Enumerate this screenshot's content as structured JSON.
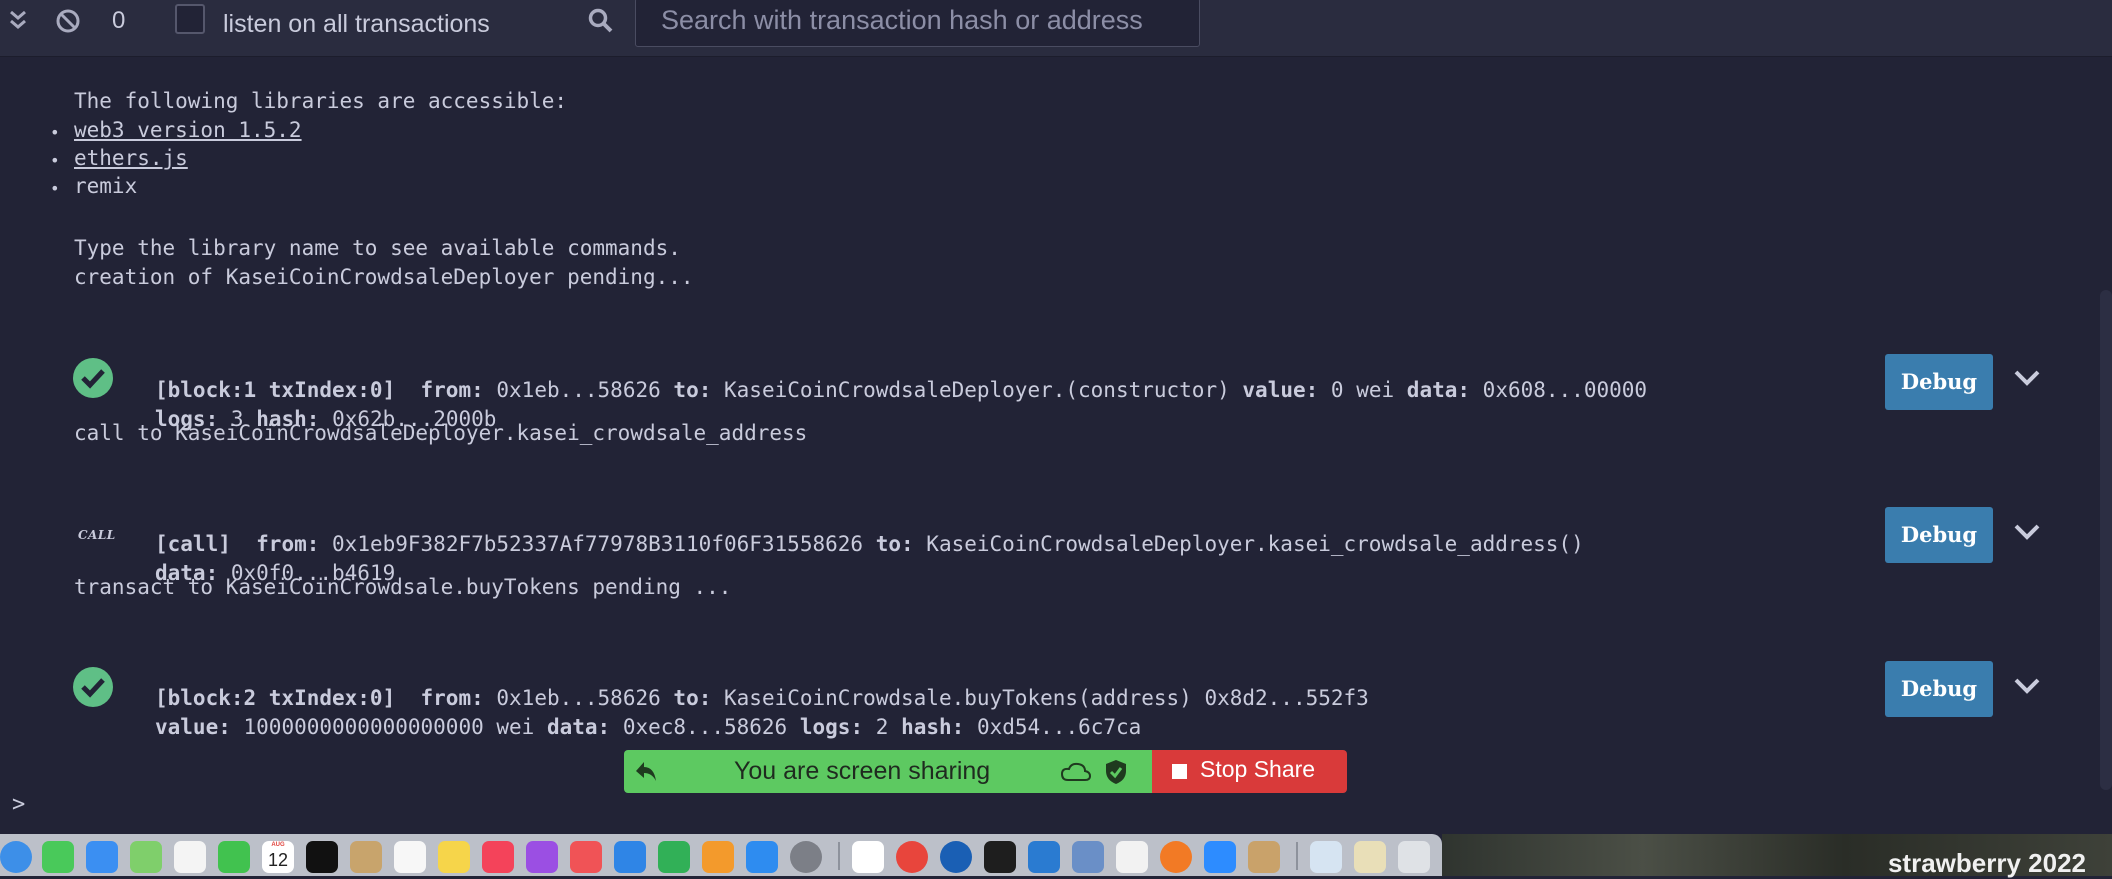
{
  "topbar": {
    "count": "0",
    "listen_label": "listen on all transactions",
    "search_placeholder": "Search with transaction hash or address"
  },
  "terminal": {
    "intro": "The following libraries are accessible:",
    "libraries": [
      "web3 version 1.5.2",
      "ethers.js",
      "remix"
    ],
    "help": "Type the library name to see available commands.",
    "creation_pending": "creation of KaseiCoinCrowdsaleDeployer pending...",
    "tx1": {
      "block": "[block:1 txIndex:0]",
      "from_label": "from:",
      "from": "0x1eb...58626",
      "to_label": "to:",
      "to": "KaseiCoinCrowdsaleDeployer.(constructor)",
      "value_label": "value:",
      "value": "0 wei",
      "data_label": "data:",
      "data": "0x608...00000",
      "logs_label": "logs:",
      "logs": "3",
      "hash_label": "hash:",
      "hash": "0x62b...2000b"
    },
    "call_line": "call to KaseiCoinCrowdsaleDeployer.kasei_crowdsale_address",
    "call_tag": "CALL",
    "tx2": {
      "block": "[call]",
      "from_label": "from:",
      "from": "0x1eb9F382F7b52337Af77978B3110f06F31558626",
      "to_label": "to:",
      "to": "KaseiCoinCrowdsaleDeployer.kasei_crowdsale_address()",
      "data_label": "data:",
      "data": "0x0f0...b4619"
    },
    "transact_line": "transact to KaseiCoinCrowdsale.buyTokens pending ...",
    "tx3": {
      "block": "[block:2 txIndex:0]",
      "from_label": "from:",
      "from": "0x1eb...58626",
      "to_label": "to:",
      "to": "KaseiCoinCrowdsale.buyTokens(address) 0x8d2...552f3",
      "value_label": "value:",
      "value": "1000000000000000000 wei",
      "data_label": "data:",
      "data": "0xec8...58626",
      "logs_label": "logs:",
      "logs": "2",
      "hash_label": "hash:",
      "hash": "0xd54...6c7ca"
    },
    "debug_label": "Debug",
    "prompt": ">"
  },
  "share_bar": {
    "text": "You are screen sharing",
    "stop_label": "Stop Share",
    "colors": {
      "green": "#5dc961",
      "red": "#d93a3a"
    }
  },
  "dock": {
    "calendar_day": "12",
    "calendar_month": "AUG",
    "desktop_label": "strawberry 2022"
  }
}
